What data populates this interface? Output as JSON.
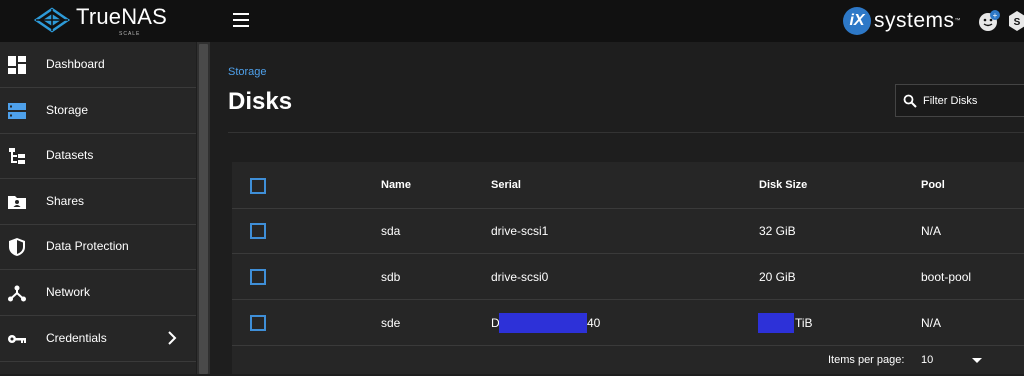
{
  "topbar": {
    "brand_name": "TrueNAS",
    "brand_edition": "SCALE",
    "menu_icon": "hamburger-menu-icon",
    "vendor_mark": "iX",
    "vendor_word": "systems",
    "vendor_tm": "™"
  },
  "sidebar": {
    "items": [
      {
        "label": "Dashboard",
        "icon": "dashboard-icon"
      },
      {
        "label": "Storage",
        "icon": "storage-icon"
      },
      {
        "label": "Datasets",
        "icon": "datasets-icon"
      },
      {
        "label": "Shares",
        "icon": "shares-icon"
      },
      {
        "label": "Data Protection",
        "icon": "shield-icon"
      },
      {
        "label": "Network",
        "icon": "network-icon"
      },
      {
        "label": "Credentials",
        "icon": "key-icon"
      }
    ]
  },
  "main": {
    "breadcrumb": "Storage",
    "title": "Disks",
    "filter_placeholder": "Filter Disks"
  },
  "table": {
    "columns": [
      "Name",
      "Serial",
      "Disk Size",
      "Pool"
    ],
    "rows": [
      {
        "name": "sda",
        "serial": "drive-scsi1",
        "size": "32 GiB",
        "pool": "N/A"
      },
      {
        "name": "sdb",
        "serial": "drive-scsi0",
        "size": "20 GiB",
        "pool": "boot-pool"
      },
      {
        "name": "sde",
        "serial_prefix": "D",
        "serial_suffix": "40",
        "size_suffix": "TiB",
        "pool": "N/A"
      }
    ],
    "footer": {
      "items_per_page_label": "Items per page:",
      "items_per_page_value": "10"
    }
  },
  "colors": {
    "accent": "#4ea0ea",
    "redaction": "#2d31d8",
    "vendor_blue": "#2d78c7"
  }
}
